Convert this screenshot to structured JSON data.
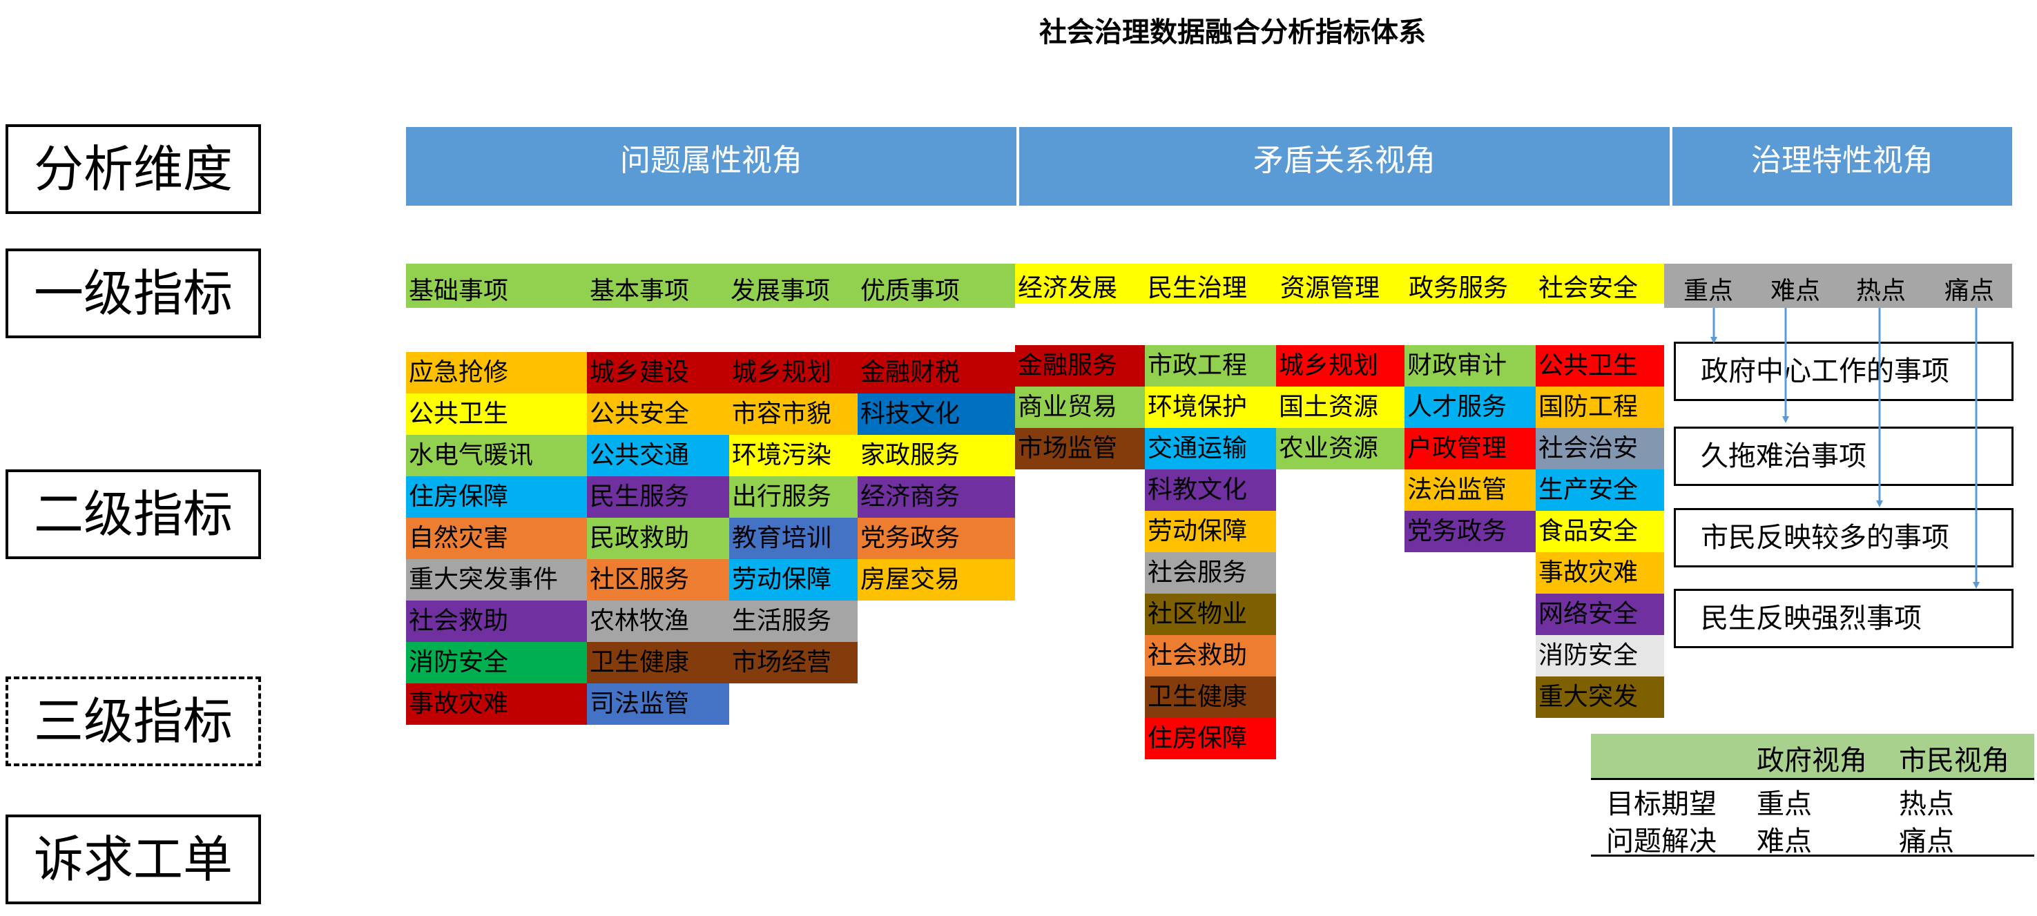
{
  "title": "社会治理数据融合分析指标体系",
  "row_labels": [
    "分析维度",
    "一级指标",
    "二级指标",
    "三级指标",
    "诉求工单"
  ],
  "views": [
    "问题属性视角",
    "矛盾关系视角",
    "治理特性视角"
  ],
  "colors": {
    "view_blue": "#5b9bd5",
    "green_band": "#92d050",
    "yellow_band": "#ffff00",
    "gray_band": "#a6a6a6",
    "orange": "#ffc000",
    "dark_red": "#c00000",
    "red": "#ff0000",
    "yellow": "#ffff00",
    "green": "#92d050",
    "blue": "#0070c0",
    "light_blue": "#00b0f0",
    "purple": "#7030a0",
    "dark_orange": "#ed7d31",
    "gray": "#a5a5a5",
    "light_gray": "#e7e6e6",
    "dark_green": "#00b050",
    "royal_blue": "#4472c4",
    "brown": "#843c0c",
    "olive": "#7f6000",
    "slate": "#8497b0",
    "arrow_blue": "#5b9bd5"
  },
  "level1": {
    "problem": [
      "基础事项",
      "基本事项",
      "发展事项",
      "优质事项"
    ],
    "conflict": [
      "经济发展",
      "民生治理",
      "资源管理",
      "政务服务",
      "社会安全"
    ],
    "governance": [
      "重点",
      "难点",
      "热点",
      "痛点"
    ]
  },
  "level2_columns": [
    {
      "items": [
        {
          "label": "应急抢修",
          "color": "#ffc000"
        },
        {
          "label": "公共卫生",
          "color": "#ffff00"
        },
        {
          "label": "水电气暖讯",
          "color": "#92d050"
        },
        {
          "label": "住房保障",
          "color": "#00b0f0"
        },
        {
          "label": "自然灾害",
          "color": "#ed7d31"
        },
        {
          "label": "重大突发事件",
          "color": "#a5a5a5"
        },
        {
          "label": "社会救助",
          "color": "#7030a0"
        },
        {
          "label": "消防安全",
          "color": "#00b050"
        },
        {
          "label": "事故灾难",
          "color": "#c00000"
        }
      ]
    },
    {
      "items": [
        {
          "label": "城乡建设",
          "color": "#c00000"
        },
        {
          "label": "公共安全",
          "color": "#ffc000"
        },
        {
          "label": "公共交通",
          "color": "#00b0f0"
        },
        {
          "label": "民生服务",
          "color": "#7030a0"
        },
        {
          "label": "民政救助",
          "color": "#92d050"
        },
        {
          "label": "社区服务",
          "color": "#ed7d31"
        },
        {
          "label": "农林牧渔",
          "color": "#a5a5a5"
        },
        {
          "label": "卫生健康",
          "color": "#843c0c"
        },
        {
          "label": "司法监管",
          "color": "#4472c4"
        }
      ]
    },
    {
      "items": [
        {
          "label": "城乡规划",
          "color": "#c00000"
        },
        {
          "label": "市容市貌",
          "color": "#ffc000"
        },
        {
          "label": "环境污染",
          "color": "#ffff00"
        },
        {
          "label": "出行服务",
          "color": "#92d050"
        },
        {
          "label": "教育培训",
          "color": "#4472c4"
        },
        {
          "label": "劳动保障",
          "color": "#00b0f0"
        },
        {
          "label": "生活服务",
          "color": "#a5a5a5"
        },
        {
          "label": "市场经营",
          "color": "#843c0c"
        }
      ]
    },
    {
      "items": [
        {
          "label": "金融财税",
          "color": "#c00000"
        },
        {
          "label": "科技文化",
          "color": "#0070c0"
        },
        {
          "label": "家政服务",
          "color": "#ffff00"
        },
        {
          "label": "经济商务",
          "color": "#7030a0"
        },
        {
          "label": "党务政务",
          "color": "#ed7d31"
        },
        {
          "label": "房屋交易",
          "color": "#ffc000"
        }
      ]
    },
    {
      "items": [
        {
          "label": "金融服务",
          "color": "#c00000"
        },
        {
          "label": "商业贸易",
          "color": "#92d050"
        },
        {
          "label": "市场监管",
          "color": "#843c0c"
        }
      ]
    },
    {
      "items": [
        {
          "label": "市政工程",
          "color": "#92d050"
        },
        {
          "label": "环境保护",
          "color": "#ffff00"
        },
        {
          "label": "交通运输",
          "color": "#00b0f0"
        },
        {
          "label": "科教文化",
          "color": "#7030a0"
        },
        {
          "label": "劳动保障",
          "color": "#ffc000"
        },
        {
          "label": "社会服务",
          "color": "#a5a5a5"
        },
        {
          "label": "社区物业",
          "color": "#7f6000"
        },
        {
          "label": "社会救助",
          "color": "#ed7d31"
        },
        {
          "label": "卫生健康",
          "color": "#843c0c"
        },
        {
          "label": "住房保障",
          "color": "#ff0000"
        }
      ]
    },
    {
      "items": [
        {
          "label": "城乡规划",
          "color": "#ff0000"
        },
        {
          "label": "国土资源",
          "color": "#ffff00"
        },
        {
          "label": "农业资源",
          "color": "#92d050"
        }
      ]
    },
    {
      "items": [
        {
          "label": "财政审计",
          "color": "#92d050"
        },
        {
          "label": "人才服务",
          "color": "#00b0f0"
        },
        {
          "label": "户政管理",
          "color": "#ff0000"
        },
        {
          "label": "法治监管",
          "color": "#ffc000"
        },
        {
          "label": "党务政务",
          "color": "#7030a0"
        }
      ]
    },
    {
      "items": [
        {
          "label": "公共卫生",
          "color": "#ff0000"
        },
        {
          "label": "国防工程",
          "color": "#ffc000"
        },
        {
          "label": "社会治安",
          "color": "#8497b0"
        },
        {
          "label": "生产安全",
          "color": "#00b0f0"
        },
        {
          "label": "食品安全",
          "color": "#ffff00"
        },
        {
          "label": "事故灾难",
          "color": "#ffc000"
        },
        {
          "label": "网络安全",
          "color": "#7030a0"
        },
        {
          "label": "消防安全",
          "color": "#e7e6e6"
        },
        {
          "label": "重大突发",
          "color": "#7f6000"
        }
      ]
    }
  ],
  "governance_items": [
    "政府中心工作的事项",
    "久拖难治事项",
    "市民反映较多的事项",
    "民生反映强烈事项"
  ],
  "legend_table": {
    "headers": [
      "",
      "政府视角",
      "市民视角"
    ],
    "rows": [
      [
        "目标期望",
        "重点",
        "热点"
      ],
      [
        "问题解决",
        "难点",
        "痛点"
      ]
    ]
  }
}
